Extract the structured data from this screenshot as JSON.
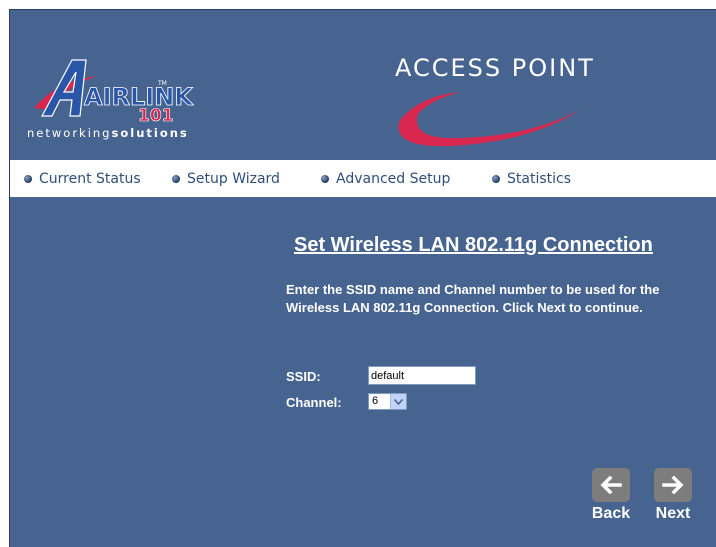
{
  "brand": {
    "logo_text": "AIRLINK",
    "logo_sub": "101",
    "logo_tm": "TM",
    "tagline_prefix": "networking",
    "tagline_bold": "solutions",
    "product_title": "ACCESS POINT",
    "colors": {
      "background": "#46648f",
      "accent": "#d8264e",
      "logo_blue": "#2a56a8"
    }
  },
  "nav": {
    "items": [
      {
        "label": "Current Status",
        "icon": "bullet-icon"
      },
      {
        "label": "Setup Wizard",
        "icon": "bullet-icon"
      },
      {
        "label": "Advanced Setup",
        "icon": "bullet-icon"
      },
      {
        "label": "Statistics",
        "icon": "bullet-icon"
      }
    ]
  },
  "main": {
    "title": "Set Wireless LAN 802.11g Connection",
    "instructions": "Enter the SSID name and Channel number to be used for the Wireless LAN 802.11g Connection. Click Next to continue.",
    "ssid_label": "SSID:",
    "ssid_value": "default",
    "channel_label": "Channel:",
    "channel_value": "6"
  },
  "buttons": {
    "back_label": "Back",
    "next_label": "Next",
    "back_icon": "arrow-left-icon",
    "next_icon": "arrow-right-icon"
  }
}
